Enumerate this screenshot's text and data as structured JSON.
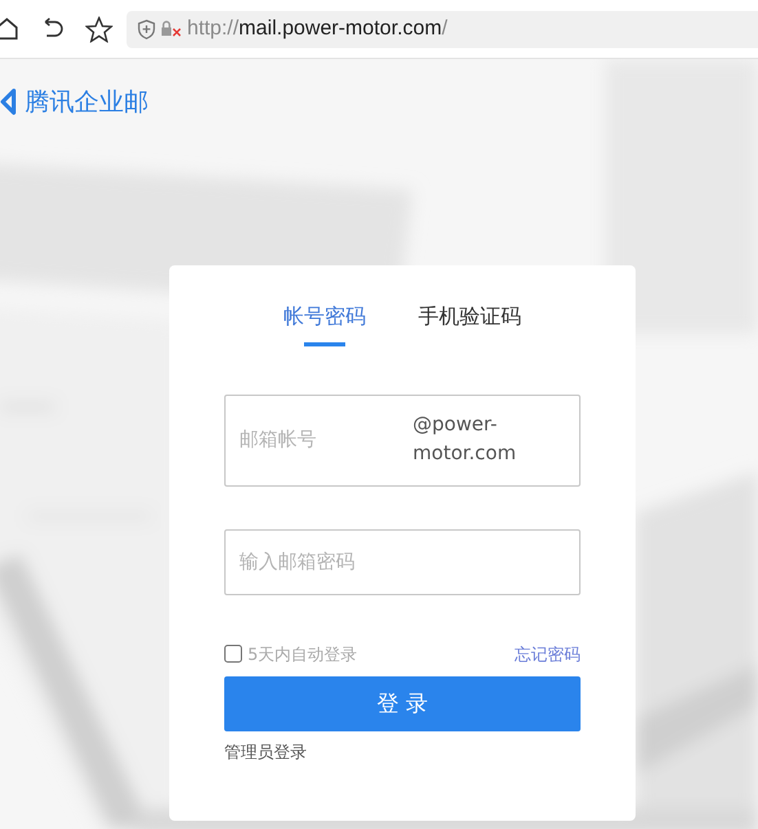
{
  "browser": {
    "url": {
      "scheme": "http://",
      "host": "mail.power-motor.com",
      "path": "/"
    }
  },
  "brand": {
    "name": "腾讯企业邮"
  },
  "tabs": [
    {
      "label": "帐号密码",
      "selected": true
    },
    {
      "label": "手机验证码",
      "selected": false
    }
  ],
  "account": {
    "placeholder": "邮箱帐号",
    "suffix": "@power-motor.com"
  },
  "password": {
    "placeholder": "输入邮箱密码"
  },
  "remember": {
    "label": "5天内自动登录",
    "checked": false
  },
  "forgot_link": "忘记密码",
  "login_button": "登 录",
  "admin_link": "管理员登录"
}
